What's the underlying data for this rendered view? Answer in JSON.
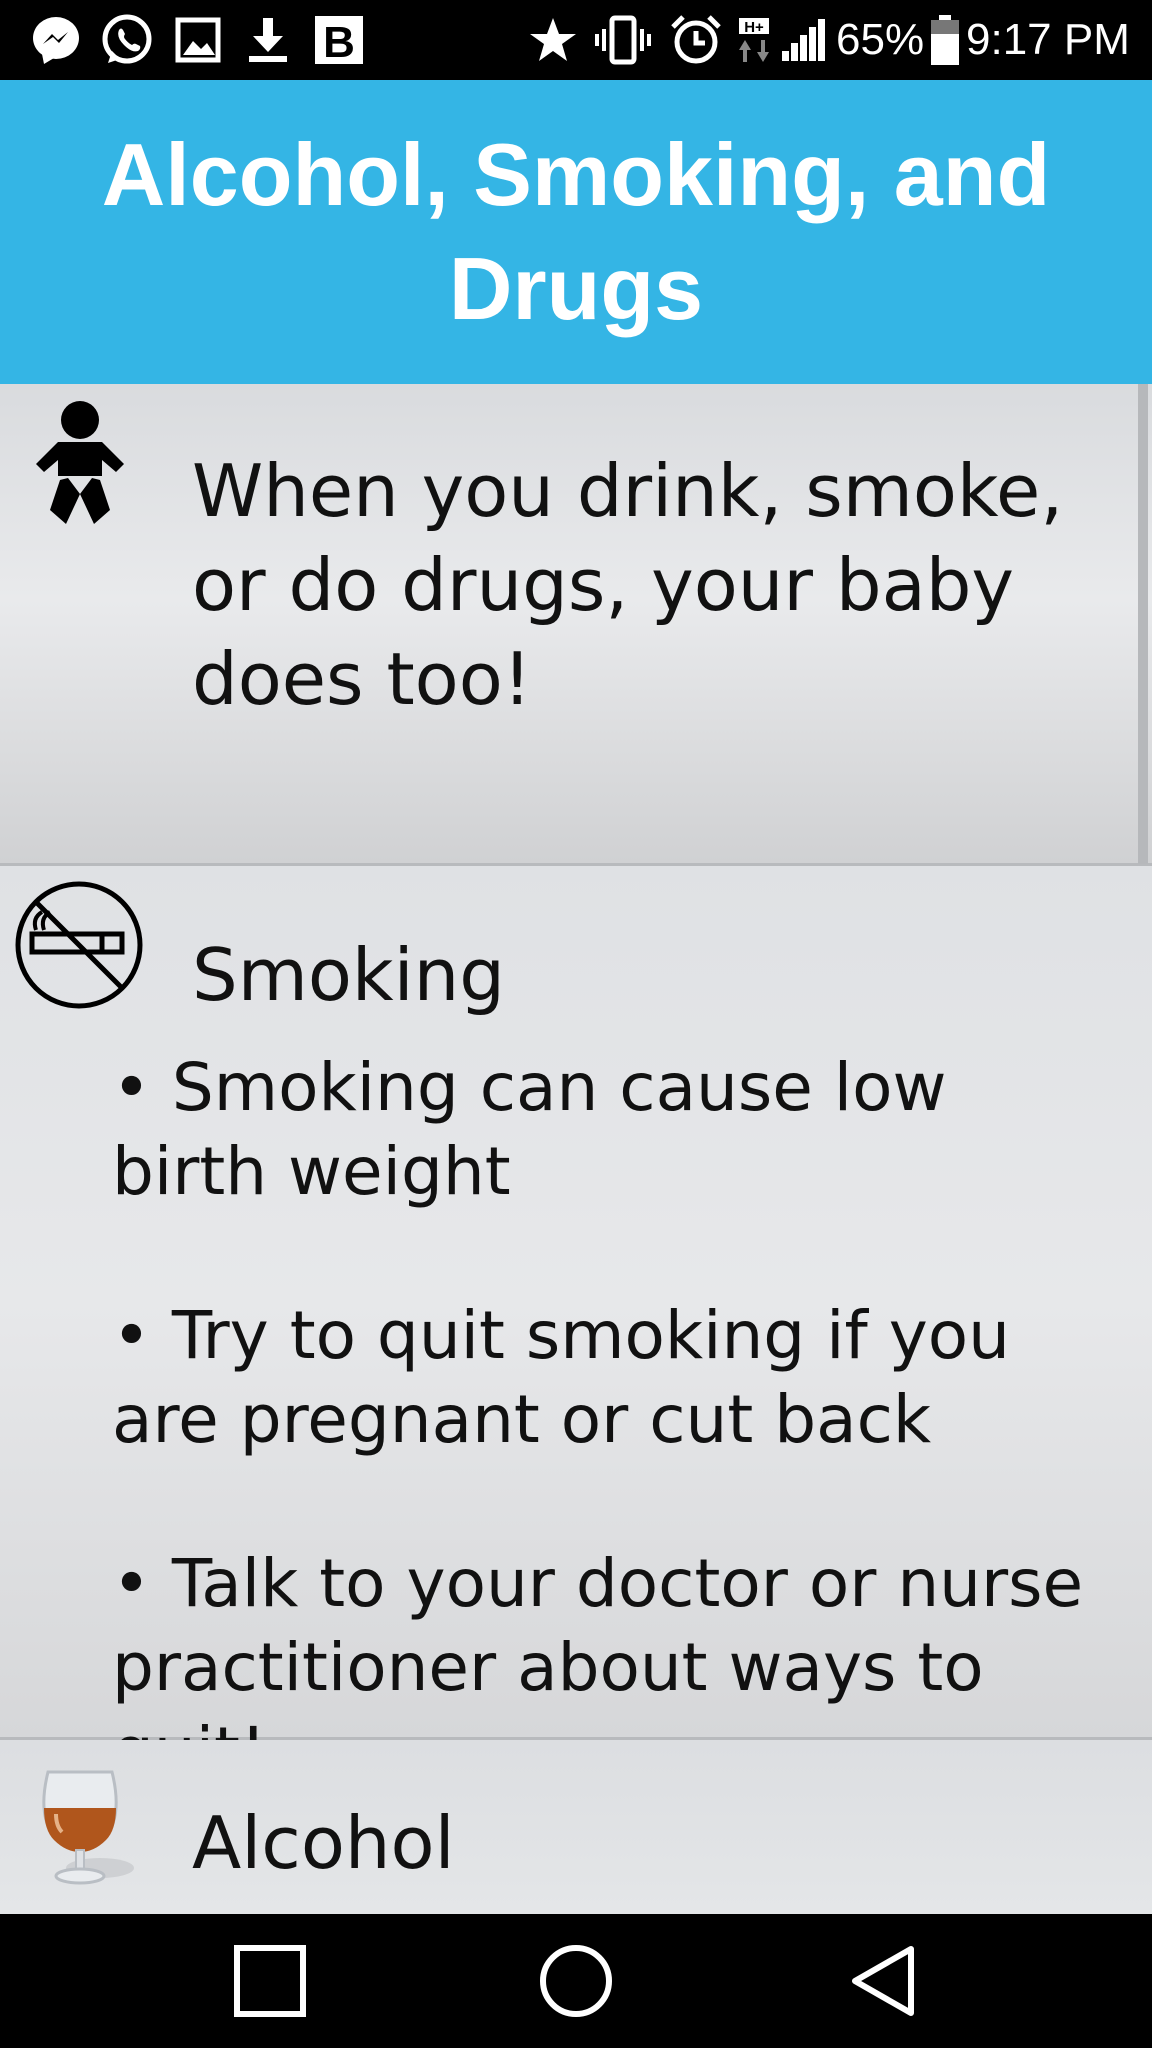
{
  "status_bar": {
    "battery": "65%",
    "time": "9:17 PM",
    "network_type": "H+",
    "notification_icons": [
      "messenger-icon",
      "whatsapp-icon",
      "gallery-icon",
      "download-icon",
      "b-app-icon"
    ],
    "system_icons": [
      "star-icon",
      "vibrate-icon",
      "alarm-icon",
      "signal-icon",
      "battery-icon"
    ]
  },
  "header": {
    "title": "Alcohol, Smoking, and Drugs",
    "background_color": "#34b5e5"
  },
  "intro": {
    "icon": "baby-icon",
    "text": "When you drink, smoke, or do drugs, your baby does too!"
  },
  "smoking": {
    "icon": "no-smoking-icon",
    "heading": "Smoking",
    "bullets": [
      "• Smoking can cause low birth weight",
      "• Try to quit smoking if you are pregnant or cut back",
      "• Talk to your doctor or nurse practitioner about ways to quit!"
    ]
  },
  "alcohol": {
    "icon": "brandy-glass-icon",
    "heading": "Alcohol"
  },
  "nav_bar": {
    "buttons": [
      "recents-button",
      "home-button",
      "back-button"
    ]
  }
}
